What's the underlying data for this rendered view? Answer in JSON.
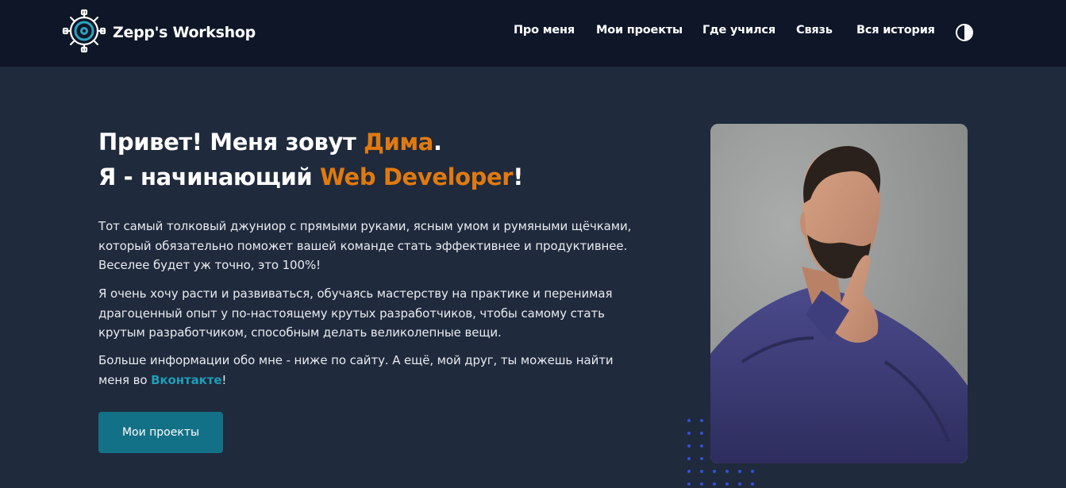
{
  "header": {
    "logo_text": "Zepp's Workshop",
    "logo_icon": "gear-icon",
    "nav": [
      {
        "label": "Про меня"
      },
      {
        "label": "Мои проекты"
      },
      {
        "label": "Где учился"
      },
      {
        "label": "Связь"
      },
      {
        "label": "Вся история"
      }
    ],
    "theme_toggle_icon": "contrast-icon"
  },
  "hero": {
    "heading_line1_before": "Привет! Меня зовут ",
    "heading_line1_accent": "Дима",
    "heading_line1_after": ".",
    "heading_line2_before": "Я - начинающий ",
    "heading_line2_accent": "Web Developer",
    "heading_line2_after": "!",
    "paragraph1": "Тот самый толковый джуниор с прямыми руками, ясным умом и румяными щёчками, который обязательно поможет вашей команде стать эффективнее и продуктивнее. Веселее будет уж точно, это 100%!",
    "paragraph2": "Я очень хочу расти и развиваться, обучаясь мастерству на практике и перенимая драгоценный опыт у по-настоящему крутых разработчиков, чтобы самому стать крутым разработчиком, способным делать великолепные вещи.",
    "paragraph3_before": "Больше информации обо мне - ниже по сайту. А ещё, мой друг, ты можешь найти меня во ",
    "paragraph3_link": "Вконтакте",
    "paragraph3_after": "!",
    "cta_label": "Мои проекты"
  },
  "colors": {
    "background": "#1f2a3c",
    "header": "#0e1628",
    "accent": "#e07a10",
    "link": "#1f9db8",
    "button": "#137187",
    "dots": "#3550d8"
  }
}
